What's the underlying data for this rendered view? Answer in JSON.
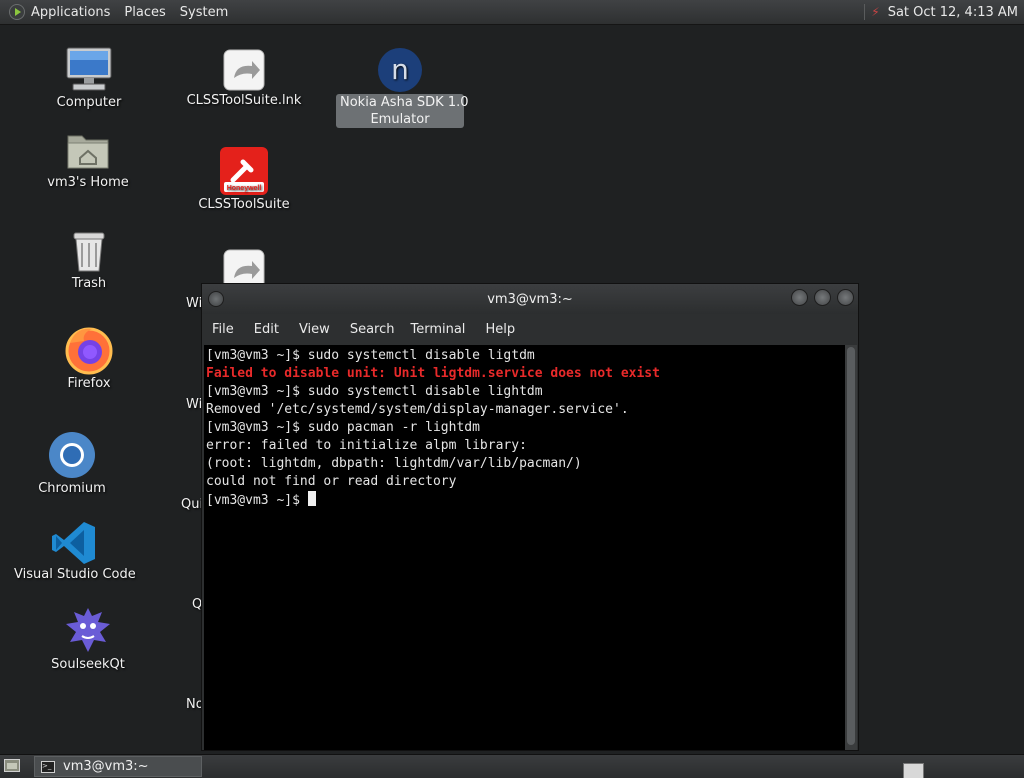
{
  "top_panel": {
    "menus": [
      "Applications",
      "Places",
      "System"
    ],
    "clock": "Sat Oct 12,  4:13 AM"
  },
  "desktop": {
    "icons": [
      {
        "label": "Computer",
        "icon": "computer-icon"
      },
      {
        "label": "vm3's Home",
        "icon": "home-folder-icon"
      },
      {
        "label": "Trash",
        "icon": "trash-icon"
      },
      {
        "label": "Firefox",
        "icon": "firefox-icon"
      },
      {
        "label": "Chromium",
        "icon": "chromium-icon"
      },
      {
        "label": "Visual Studio Code",
        "icon": "vscode-icon"
      },
      {
        "label": "SoulseekQt",
        "icon": "soulseek-icon"
      },
      {
        "label": "CLSSToolSuite.lnk",
        "icon": "shortcut-icon"
      },
      {
        "label": "CLSSToolSuite",
        "icon": "honeywell-icon",
        "badge": "Honeywell"
      },
      {
        "label_line1": "Nokia Asha SDK 1.0",
        "label_line2": "Emulator",
        "icon": "nokia-icon",
        "glyph": "n"
      }
    ],
    "partial_labels": [
      "Wi",
      "Wi",
      "Qui",
      "Q",
      "No"
    ]
  },
  "terminal": {
    "title": "vm3@vm3:~",
    "menu": [
      "File",
      "Edit",
      "View",
      "Search",
      "Terminal",
      "Help"
    ],
    "lines": [
      {
        "text": "[vm3@vm3 ~]$ sudo systemctl disable ligtdm",
        "error": false
      },
      {
        "text": "Failed to disable unit: Unit ligtdm.service does not exist",
        "error": true
      },
      {
        "text": "[vm3@vm3 ~]$ sudo systemctl disable lightdm",
        "error": false
      },
      {
        "text": "Removed '/etc/systemd/system/display-manager.service'.",
        "error": false
      },
      {
        "text": "[vm3@vm3 ~]$ sudo pacman -r lightdm",
        "error": false
      },
      {
        "text": "error: failed to initialize alpm library:",
        "error": false
      },
      {
        "text": "(root: lightdm, dbpath: lightdm/var/lib/pacman/)",
        "error": false
      },
      {
        "text": "could not find or read directory",
        "error": false
      }
    ],
    "prompt": "[vm3@vm3 ~]$ "
  },
  "bottom_panel": {
    "task_label": "vm3@vm3:~"
  },
  "colors": {
    "error_text": "#e82a2a",
    "terminal_bg": "#000000",
    "panel_bg": "#333536",
    "desktop_bg": "#1f2122"
  }
}
